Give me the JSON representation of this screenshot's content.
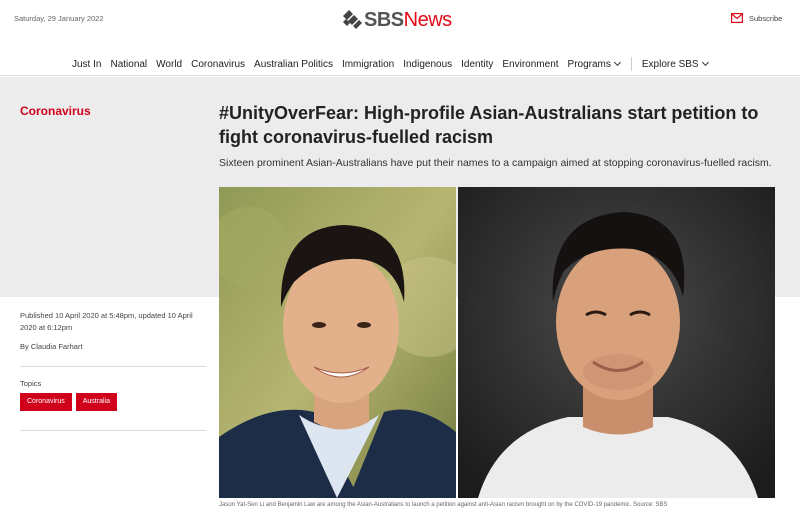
{
  "header": {
    "date": "Saturday, 29 January 2022",
    "logo_sbs": "SBS",
    "logo_news": "News",
    "subscribe_label": "Subscribe"
  },
  "nav": {
    "items": [
      {
        "label": "Just In"
      },
      {
        "label": "National"
      },
      {
        "label": "World"
      },
      {
        "label": "Coronavirus"
      },
      {
        "label": "Australian Politics"
      },
      {
        "label": "Immigration"
      },
      {
        "label": "Indigenous"
      },
      {
        "label": "Identity"
      },
      {
        "label": "Environment"
      },
      {
        "label": "Programs"
      }
    ],
    "explore_label": "Explore SBS"
  },
  "article": {
    "section": "Coronavirus",
    "headline": "#UnityOverFear: High-profile Asian-Australians start petition to fight coronavirus-fuelled racism",
    "standfirst": "Sixteen prominent Asian-Australians have put their names to a campaign aimed at stopping coronavirus-fuelled racism.",
    "published": "Published 10 April 2020 at 5:48pm, updated 10 April 2020 at 6:12pm",
    "byline": "By Claudia Farhart",
    "topics_label": "Topics",
    "topics": [
      "Coronavirus",
      "Australia"
    ],
    "caption": "Jason Yat-Sen Li and Benjamin Law are among the Asian-Australians to launch a petition against anti-Asian racism brought on by the COVID-19 pandemic. Source: SBS"
  },
  "colors": {
    "brand_red": "#d0021b",
    "hero_grey": "#ececec"
  }
}
